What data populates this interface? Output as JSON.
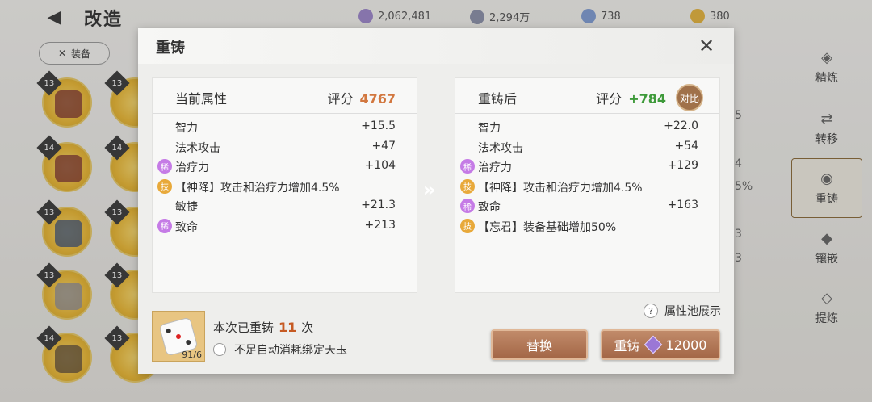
{
  "background": {
    "title": "改造",
    "currencies": [
      "2,062,481",
      "2,294万",
      "738",
      "380"
    ],
    "filter_label": "装备",
    "slot_levels": [
      "13",
      "13",
      "14",
      "14",
      "13",
      "13",
      "13",
      "13",
      "14",
      "13"
    ],
    "side_numbers": [
      "5",
      "4",
      "5%",
      "3",
      "3"
    ],
    "nav": [
      "精炼",
      "转移",
      "重铸",
      "镶嵌",
      "提炼"
    ]
  },
  "dialog": {
    "title": "重铸",
    "current": {
      "title": "当前属性",
      "score_label": "评分",
      "score": "4767",
      "rows": [
        {
          "tag": "",
          "name": "智力",
          "value": "+15.5"
        },
        {
          "tag": "",
          "name": "法术攻击",
          "value": "+47"
        },
        {
          "tag": "稀",
          "name": "治疗力",
          "value": "+104"
        },
        {
          "tag": "技",
          "name": "【神降】攻击和治疗力增加4.5%",
          "value": ""
        },
        {
          "tag": "",
          "name": "敏捷",
          "value": "+21.3"
        },
        {
          "tag": "稀",
          "name": "致命",
          "value": "+213"
        }
      ]
    },
    "after": {
      "title": "重铸后",
      "score_label": "评分",
      "score": "+784",
      "compare_label": "对比",
      "rows": [
        {
          "tag": "",
          "name": "智力",
          "value": "+22.0"
        },
        {
          "tag": "",
          "name": "法术攻击",
          "value": "+54"
        },
        {
          "tag": "稀",
          "name": "治疗力",
          "value": "+129"
        },
        {
          "tag": "技",
          "name": "【神降】攻击和治疗力增加4.5%",
          "value": ""
        },
        {
          "tag": "稀",
          "name": "致命",
          "value": "+163"
        },
        {
          "tag": "技",
          "name": "【忘君】装备基础增加50%",
          "value": ""
        }
      ]
    },
    "item_count": "91/6",
    "times_prefix": "本次已重铸",
    "times_value": "11",
    "times_suffix": "次",
    "auto_label": "不足自动消耗绑定天玉",
    "pool_label": "属性池展示",
    "replace_label": "替换",
    "reforge_label": "重铸",
    "reforge_cost": "12000"
  },
  "colors": {
    "score_current": "#d2773f",
    "score_after": "#3e9a3a",
    "button": "#b07a58"
  }
}
